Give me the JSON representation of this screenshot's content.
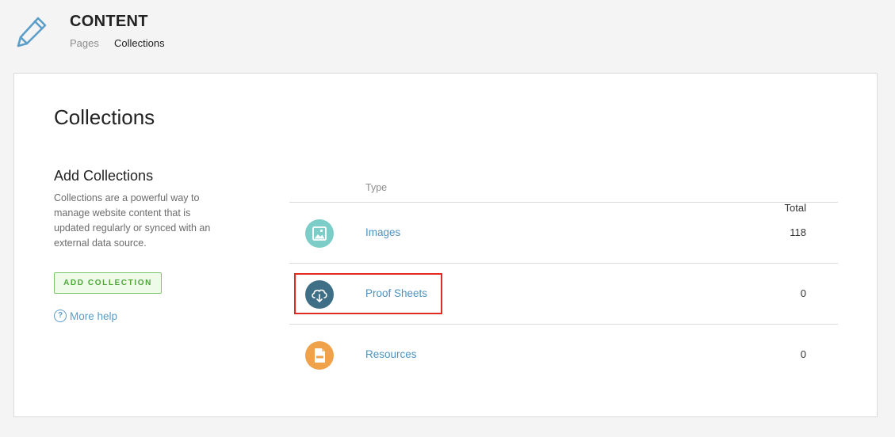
{
  "header": {
    "icon": "pencil-icon",
    "title": "CONTENT",
    "breadcrumb": [
      "Pages",
      "Collections"
    ]
  },
  "main": {
    "title": "Collections",
    "sidebar": {
      "heading": "Add Collections",
      "description": "Collections are a powerful way to manage website content that is updated regularly or synced with an external data source.",
      "add_button": "ADD COLLECTION",
      "help_icon": "question-circle-icon",
      "help_link": "More help"
    },
    "table": {
      "columns": [
        "Type",
        "Total"
      ],
      "rows": [
        {
          "icon": "image-icon",
          "icon_color": "#7ccdc8",
          "name": "Images",
          "total": "118"
        },
        {
          "icon": "cloud-download-icon",
          "icon_color": "#3f6f87",
          "name": "Proof Sheets",
          "total": "0",
          "highlighted": true
        },
        {
          "icon": "pdf-file-icon",
          "icon_color": "#f0a24a",
          "name": "Resources",
          "total": "0"
        }
      ]
    }
  },
  "colors": {
    "accent": "#5a9cc6",
    "add_button": "#4ea63a",
    "highlight": "#e02a23"
  }
}
